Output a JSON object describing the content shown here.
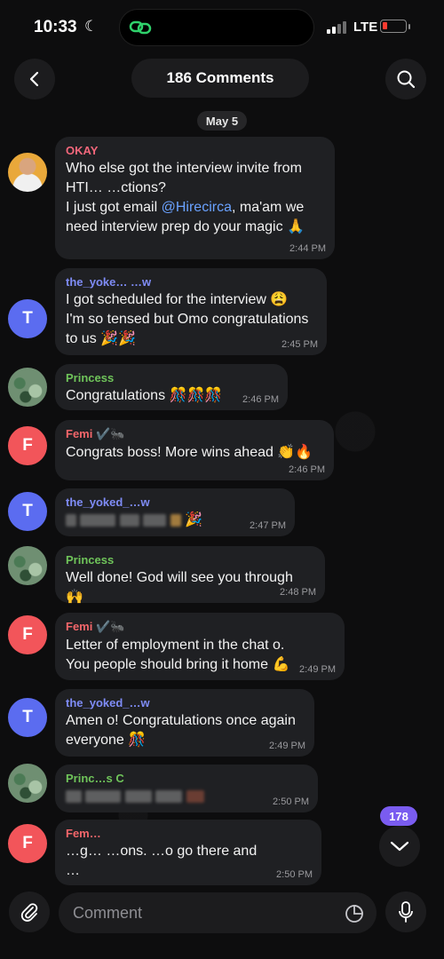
{
  "status": {
    "time": "10:33",
    "network": "LTE"
  },
  "header": {
    "title": "186 Comments"
  },
  "date_divider": "May 5",
  "messages": [
    {
      "sender": "OKAY",
      "avatar": "",
      "lines": [
        "Who else got the interview invite from",
        "HTI… …ctions?",
        "I just got email ",
        "@Hirecirca",
        ", ma'am we",
        "need interview prep do your magic 🙏"
      ],
      "time": "2:44 PM"
    },
    {
      "sender": "the_yoke… …w",
      "avatar": "T",
      "lines": [
        "I got scheduled for the interview 😩",
        "I'm so tensed but Omo congratulations",
        "to us 🎉🎉"
      ],
      "time": "2:45 PM"
    },
    {
      "sender": "Princess",
      "avatar": "",
      "lines": [
        "Congratulations 🎊🎊🎊"
      ],
      "time": "2:46 PM"
    },
    {
      "sender": "Femi ✔️🐜",
      "avatar": "F",
      "lines": [
        "Congrats boss! More wins ahead 👏🔥"
      ],
      "time": "2:46 PM"
    },
    {
      "sender": "the_yoked_…w",
      "avatar": "T",
      "lines": [
        "🎉"
      ],
      "time": "2:47 PM"
    },
    {
      "sender": "Princess",
      "avatar": "",
      "lines": [
        "Well done! God will see you through 🙌"
      ],
      "time": "2:48 PM"
    },
    {
      "sender": "Femi ✔️🐜",
      "avatar": "F",
      "lines": [
        "Letter of employment in the chat o.",
        "You people should bring it home 💪"
      ],
      "time": "2:49 PM"
    },
    {
      "sender": "the_yoked_…w",
      "avatar": "T",
      "lines": [
        "Amen o! Congratulations once again",
        "everyone 🎊"
      ],
      "time": "2:49 PM"
    },
    {
      "sender": "Princ…s C",
      "avatar": "",
      "lines": [
        ""
      ],
      "time": "2:50 PM"
    },
    {
      "sender": "Fem…",
      "avatar": "F",
      "lines": [
        "…g… …ons. …o go there and",
        "…"
      ],
      "time": "2:50 PM"
    }
  ],
  "unread_count": "178",
  "composer": {
    "placeholder": "Comment"
  },
  "icons": [
    "back-icon",
    "search-icon",
    "link-icon",
    "attach-icon",
    "sticker-icon",
    "mic-icon",
    "chevron-down-icon"
  ],
  "colors": {
    "okay": "#f4677b",
    "yoked": "#7f8cf6",
    "princess": "#6fc45a",
    "femi": "#f2666a",
    "mention": "#6aa2ff",
    "unread_badge": "#7a5cf0"
  }
}
